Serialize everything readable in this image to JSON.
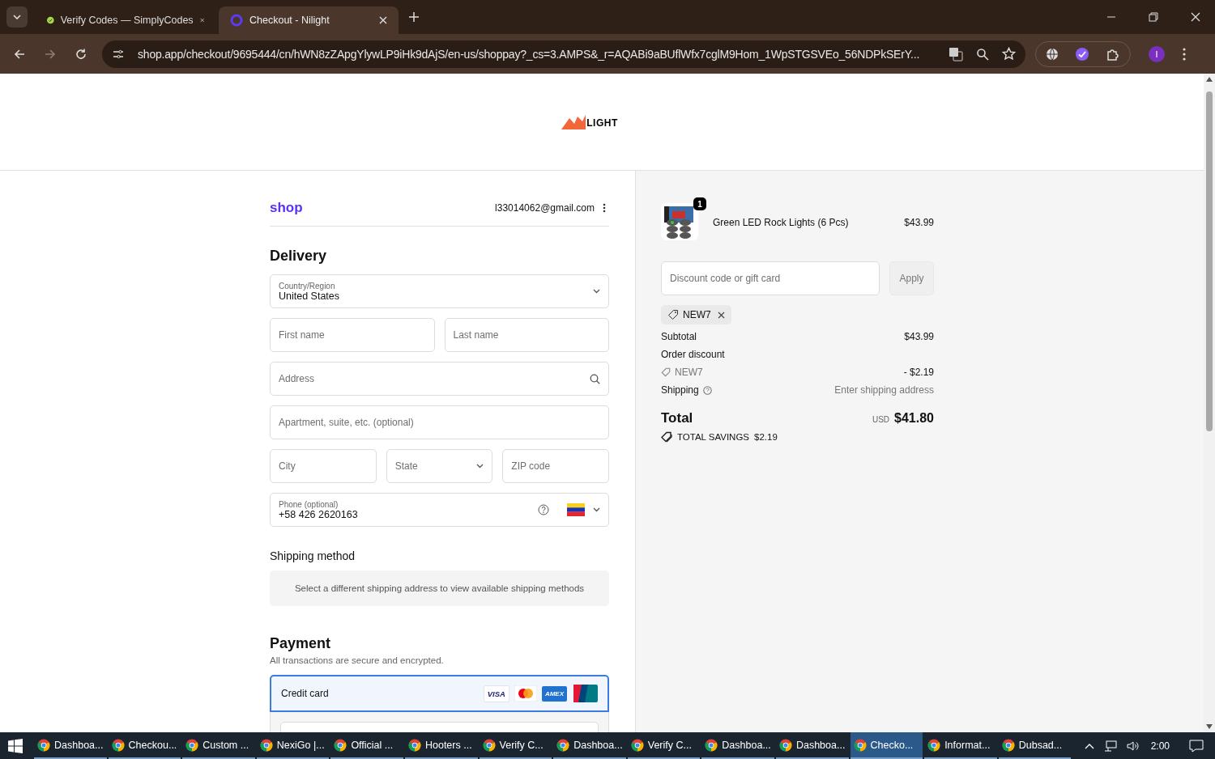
{
  "browser": {
    "tabs": [
      {
        "title": "Verify Codes — SimplyCodes",
        "selected": false
      },
      {
        "title": "Checkout - Nilight",
        "selected": true
      }
    ],
    "url": "shop.app/checkout/9695444/cn/hWN8zZApgYlywLP9iHk9dAjS/en-us/shoppay?_cs=3.AMPS&_r=AQABi9aBUflWfx7cglM9Hom_1WpSTGSVEo_56NDPkSErY...",
    "profile_initial": "I"
  },
  "store": {
    "logo_text": "LIGHT"
  },
  "account": {
    "brand": "shop",
    "email": "l33014062@gmail.com"
  },
  "delivery": {
    "heading": "Delivery",
    "country": {
      "label": "Country/Region",
      "value": "United States"
    },
    "first_name": {
      "placeholder": "First name"
    },
    "last_name": {
      "placeholder": "Last name"
    },
    "address": {
      "placeholder": "Address"
    },
    "apartment": {
      "placeholder": "Apartment, suite, etc. (optional)"
    },
    "city": {
      "placeholder": "City"
    },
    "state": {
      "placeholder": "State"
    },
    "zip": {
      "placeholder": "ZIP code"
    },
    "phone": {
      "label": "Phone (optional)",
      "value": "+58 426 2620163"
    }
  },
  "shipping_method": {
    "heading": "Shipping method",
    "notice": "Select a different shipping address to view available shipping methods"
  },
  "payment": {
    "heading": "Payment",
    "subtitle": "All transactions are secure and encrypted.",
    "methods": [
      {
        "label": "Credit card",
        "selected": true,
        "card_logos": [
          "VISA",
          "AMEX"
        ]
      }
    ]
  },
  "summary": {
    "items": [
      {
        "name": "Green LED Rock Lights (6 Pcs)",
        "quantity": "1",
        "price": "$43.99"
      }
    ],
    "discount_field": {
      "placeholder": "Discount code or gift card"
    },
    "apply_button": "Apply",
    "applied_codes": [
      "NEW7"
    ],
    "subtotal": {
      "label": "Subtotal",
      "value": "$43.99"
    },
    "order_discount": {
      "label": "Order discount",
      "code": "NEW7",
      "value": "- $2.19"
    },
    "shipping": {
      "label": "Shipping",
      "value": "Enter shipping address"
    },
    "total": {
      "label": "Total",
      "currency": "USD",
      "value": "$41.80"
    },
    "savings": {
      "label": "TOTAL SAVINGS",
      "value": "$2.19"
    }
  },
  "taskbar": {
    "items": [
      {
        "label": "Dashboa...",
        "selected": false
      },
      {
        "label": "Checkou...",
        "selected": false
      },
      {
        "label": "Custom ...",
        "selected": false
      },
      {
        "label": "NexiGo |...",
        "selected": false
      },
      {
        "label": "Official ...",
        "selected": false
      },
      {
        "label": "Hooters ...",
        "selected": false
      },
      {
        "label": "Verify C...",
        "selected": false
      },
      {
        "label": "Dashboa...",
        "selected": false
      },
      {
        "label": "Verify C...",
        "selected": false
      },
      {
        "label": "Dashboa...",
        "selected": false
      },
      {
        "label": "Dashboa...",
        "selected": false
      },
      {
        "label": "Checko...",
        "selected": true
      },
      {
        "label": "Informat...",
        "selected": false
      },
      {
        "label": "Dubsad...",
        "selected": false
      }
    ],
    "time": "2:00"
  }
}
